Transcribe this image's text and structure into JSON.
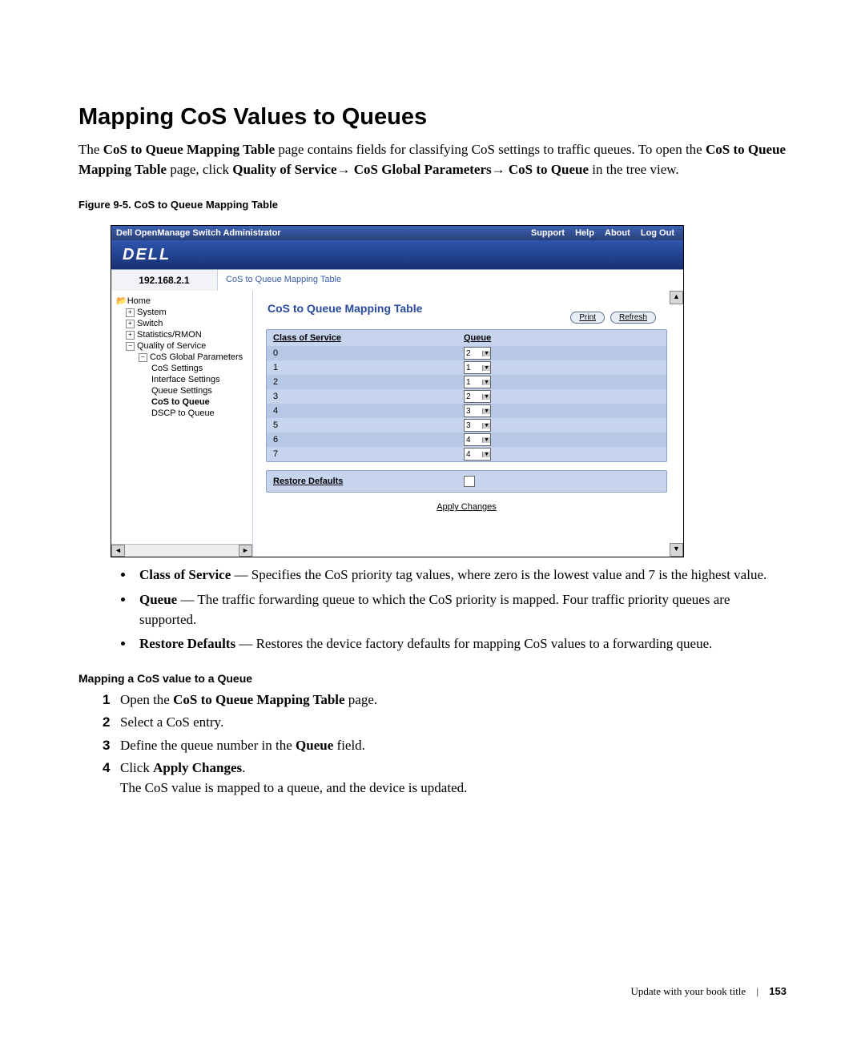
{
  "heading": "Mapping CoS Values to Queues",
  "intro_html": "The <b>CoS to Queue Mapping Table</b> page contains fields for classifying CoS settings to traffic queues. To open the <b>CoS to Queue Mapping Table</b> page, click <b>Quality of Service</b>→ <b>CoS Global Parameters</b>→ <b>CoS to Queue</b> in the tree view.",
  "figure_caption": "Figure 9-5.   CoS to Queue Mapping Table",
  "shot": {
    "titlebar_left": "Dell OpenManage Switch Administrator",
    "titlebar_links": [
      "Support",
      "Help",
      "About",
      "Log Out"
    ],
    "logo": "DELL",
    "ip": "192.168.2.1",
    "breadcrumb": "CoS to Queue Mapping Table",
    "tree": {
      "home": "Home",
      "system": "System",
      "switch": "Switch",
      "stats": "Statistics/RMON",
      "qos": "Quality of Service",
      "cos_global": "CoS Global Parameters",
      "cos_settings": "CoS Settings",
      "iface": "Interface Settings",
      "queue": "Queue Settings",
      "cos_to_queue": "CoS to Queue",
      "dscp": "DSCP to Queue"
    },
    "content_title": "CoS to Queue Mapping Table",
    "btn_print": "Print",
    "btn_refresh": "Refresh",
    "col_cos": "Class of Service",
    "col_queue": "Queue",
    "rows": [
      {
        "cos": "0",
        "q": "2"
      },
      {
        "cos": "1",
        "q": "1"
      },
      {
        "cos": "2",
        "q": "1"
      },
      {
        "cos": "3",
        "q": "2"
      },
      {
        "cos": "4",
        "q": "3"
      },
      {
        "cos": "5",
        "q": "3"
      },
      {
        "cos": "6",
        "q": "4"
      },
      {
        "cos": "7",
        "q": "4"
      }
    ],
    "restore_label": "Restore Defaults",
    "apply_label": "Apply Changes"
  },
  "bullets": [
    "<b>Class of Service</b> — Specifies the CoS priority tag values, where zero is the lowest value and 7 is the highest value.",
    "<b>Queue</b> — The traffic forwarding queue to which the CoS priority is mapped. Four traffic priority queues are supported.",
    "<b>Restore Defaults</b> — Restores the device factory defaults for mapping CoS values to a forwarding queue."
  ],
  "subhead": "Mapping a CoS value to a Queue",
  "steps": [
    "Open the <b>CoS to Queue Mapping Table</b> page.",
    "Select a CoS entry.",
    "Define the queue number in the <b>Queue</b> field.",
    "Click <b>Apply Changes</b>."
  ],
  "step_tail": "The CoS value is mapped to a queue, and the device is updated.",
  "footer_title": "Update with your book title",
  "footer_page": "153"
}
